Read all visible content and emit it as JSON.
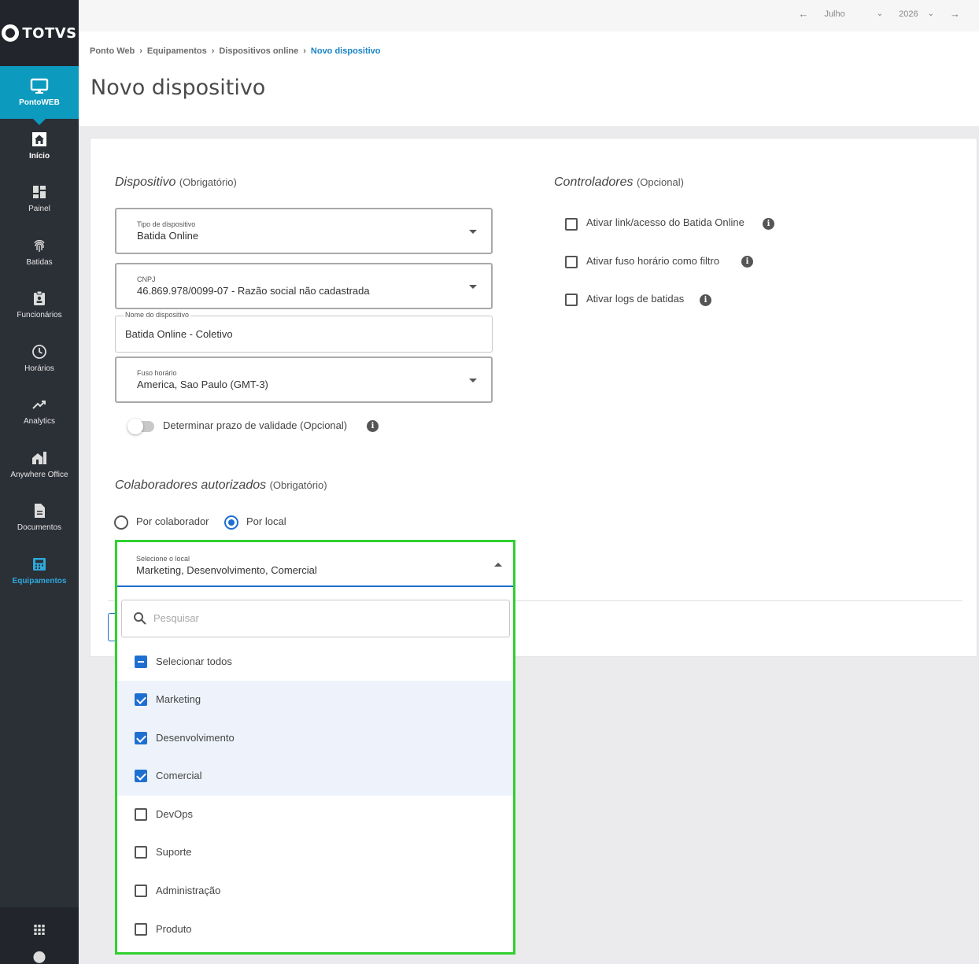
{
  "sidebar": {
    "logo": "TOTVS",
    "brand_label": "PontoWEB",
    "items": [
      {
        "label": "Início",
        "icon": "home-icon"
      },
      {
        "label": "Painel",
        "icon": "dashboard-icon"
      },
      {
        "label": "Batidas",
        "icon": "fingerprint-icon"
      },
      {
        "label": "Funcionários",
        "icon": "badge-icon"
      },
      {
        "label": "Horários",
        "icon": "clock-icon"
      },
      {
        "label": "Analytics",
        "icon": "trending-up-icon"
      },
      {
        "label": "Anywhere Office",
        "icon": "home-work-icon"
      },
      {
        "label": "Documentos",
        "icon": "document-icon"
      },
      {
        "label": "Equipamentos",
        "icon": "device-icon"
      }
    ]
  },
  "topbar": {
    "month": "Julho",
    "year": "2026"
  },
  "breadcrumb": [
    "Ponto Web",
    "Equipamentos",
    "Dispositivos online",
    "Novo dispositivo"
  ],
  "page_title": "Novo dispositivo",
  "dispositivo": {
    "title": "Dispositivo",
    "note": "(Obrigatório)",
    "tipo": {
      "label": "Tipo de dispositivo",
      "value": "Batida Online"
    },
    "cnpj": {
      "label": "CNPJ",
      "value": "46.869.978/0099-07 - Razão social não cadastrada"
    },
    "nome": {
      "label": "Nome do dispositivo",
      "value": "Batida Online - Coletivo"
    },
    "fuso": {
      "label": "Fuso horário",
      "value": "America, Sao Paulo (GMT-3)"
    },
    "validade_label": "Determinar prazo de validade (Opcional)"
  },
  "controladores": {
    "title": "Controladores",
    "note": "(Opcional)",
    "options": [
      "Ativar link/acesso do Batida Online",
      "Ativar fuso horário como filtro",
      "Ativar logs de batidas"
    ]
  },
  "colaboradores": {
    "title": "Colaboradores autorizados",
    "note": "(Obrigatório)",
    "radio_colaborador": "Por colaborador",
    "radio_local": "Por local",
    "select": {
      "label": "Selecione o local",
      "value": "Marketing, Desenvolvimento, Comercial"
    },
    "search_placeholder": "Pesquisar",
    "select_all": "Selecionar todos",
    "options": [
      {
        "label": "Marketing",
        "checked": true
      },
      {
        "label": "Desenvolvimento",
        "checked": true
      },
      {
        "label": "Comercial",
        "checked": true
      },
      {
        "label": "DevOps",
        "checked": false
      },
      {
        "label": "Suporte",
        "checked": false
      },
      {
        "label": "Administração",
        "checked": false
      },
      {
        "label": "Produto",
        "checked": false
      }
    ]
  },
  "colors": {
    "accent": "#0c9abe",
    "primary": "#1f6fd0",
    "highlight": "#2fd12f",
    "sidebar": "#2b2f36"
  }
}
